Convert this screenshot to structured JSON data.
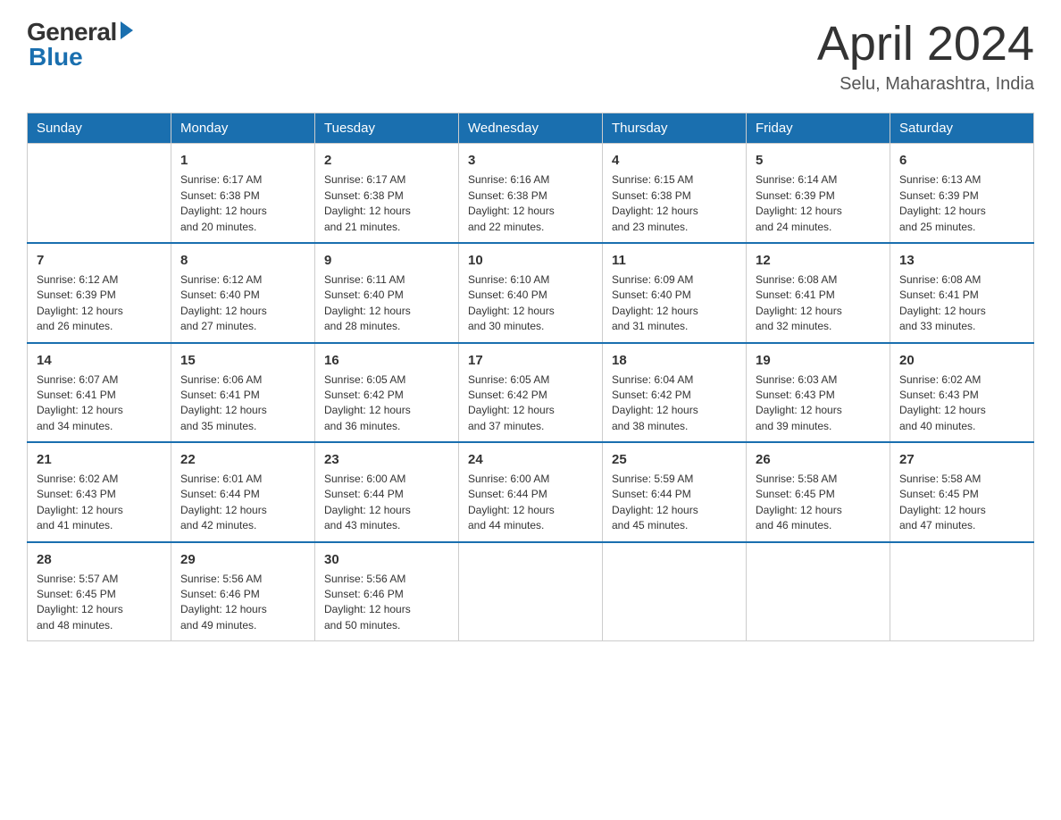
{
  "header": {
    "logo": {
      "general": "General",
      "blue": "Blue"
    },
    "title": "April 2024",
    "location": "Selu, Maharashtra, India"
  },
  "days_of_week": [
    "Sunday",
    "Monday",
    "Tuesday",
    "Wednesday",
    "Thursday",
    "Friday",
    "Saturday"
  ],
  "weeks": [
    [
      {
        "day": "",
        "info": ""
      },
      {
        "day": "1",
        "info": "Sunrise: 6:17 AM\nSunset: 6:38 PM\nDaylight: 12 hours\nand 20 minutes."
      },
      {
        "day": "2",
        "info": "Sunrise: 6:17 AM\nSunset: 6:38 PM\nDaylight: 12 hours\nand 21 minutes."
      },
      {
        "day": "3",
        "info": "Sunrise: 6:16 AM\nSunset: 6:38 PM\nDaylight: 12 hours\nand 22 minutes."
      },
      {
        "day": "4",
        "info": "Sunrise: 6:15 AM\nSunset: 6:38 PM\nDaylight: 12 hours\nand 23 minutes."
      },
      {
        "day": "5",
        "info": "Sunrise: 6:14 AM\nSunset: 6:39 PM\nDaylight: 12 hours\nand 24 minutes."
      },
      {
        "day": "6",
        "info": "Sunrise: 6:13 AM\nSunset: 6:39 PM\nDaylight: 12 hours\nand 25 minutes."
      }
    ],
    [
      {
        "day": "7",
        "info": "Sunrise: 6:12 AM\nSunset: 6:39 PM\nDaylight: 12 hours\nand 26 minutes."
      },
      {
        "day": "8",
        "info": "Sunrise: 6:12 AM\nSunset: 6:40 PM\nDaylight: 12 hours\nand 27 minutes."
      },
      {
        "day": "9",
        "info": "Sunrise: 6:11 AM\nSunset: 6:40 PM\nDaylight: 12 hours\nand 28 minutes."
      },
      {
        "day": "10",
        "info": "Sunrise: 6:10 AM\nSunset: 6:40 PM\nDaylight: 12 hours\nand 30 minutes."
      },
      {
        "day": "11",
        "info": "Sunrise: 6:09 AM\nSunset: 6:40 PM\nDaylight: 12 hours\nand 31 minutes."
      },
      {
        "day": "12",
        "info": "Sunrise: 6:08 AM\nSunset: 6:41 PM\nDaylight: 12 hours\nand 32 minutes."
      },
      {
        "day": "13",
        "info": "Sunrise: 6:08 AM\nSunset: 6:41 PM\nDaylight: 12 hours\nand 33 minutes."
      }
    ],
    [
      {
        "day": "14",
        "info": "Sunrise: 6:07 AM\nSunset: 6:41 PM\nDaylight: 12 hours\nand 34 minutes."
      },
      {
        "day": "15",
        "info": "Sunrise: 6:06 AM\nSunset: 6:41 PM\nDaylight: 12 hours\nand 35 minutes."
      },
      {
        "day": "16",
        "info": "Sunrise: 6:05 AM\nSunset: 6:42 PM\nDaylight: 12 hours\nand 36 minutes."
      },
      {
        "day": "17",
        "info": "Sunrise: 6:05 AM\nSunset: 6:42 PM\nDaylight: 12 hours\nand 37 minutes."
      },
      {
        "day": "18",
        "info": "Sunrise: 6:04 AM\nSunset: 6:42 PM\nDaylight: 12 hours\nand 38 minutes."
      },
      {
        "day": "19",
        "info": "Sunrise: 6:03 AM\nSunset: 6:43 PM\nDaylight: 12 hours\nand 39 minutes."
      },
      {
        "day": "20",
        "info": "Sunrise: 6:02 AM\nSunset: 6:43 PM\nDaylight: 12 hours\nand 40 minutes."
      }
    ],
    [
      {
        "day": "21",
        "info": "Sunrise: 6:02 AM\nSunset: 6:43 PM\nDaylight: 12 hours\nand 41 minutes."
      },
      {
        "day": "22",
        "info": "Sunrise: 6:01 AM\nSunset: 6:44 PM\nDaylight: 12 hours\nand 42 minutes."
      },
      {
        "day": "23",
        "info": "Sunrise: 6:00 AM\nSunset: 6:44 PM\nDaylight: 12 hours\nand 43 minutes."
      },
      {
        "day": "24",
        "info": "Sunrise: 6:00 AM\nSunset: 6:44 PM\nDaylight: 12 hours\nand 44 minutes."
      },
      {
        "day": "25",
        "info": "Sunrise: 5:59 AM\nSunset: 6:44 PM\nDaylight: 12 hours\nand 45 minutes."
      },
      {
        "day": "26",
        "info": "Sunrise: 5:58 AM\nSunset: 6:45 PM\nDaylight: 12 hours\nand 46 minutes."
      },
      {
        "day": "27",
        "info": "Sunrise: 5:58 AM\nSunset: 6:45 PM\nDaylight: 12 hours\nand 47 minutes."
      }
    ],
    [
      {
        "day": "28",
        "info": "Sunrise: 5:57 AM\nSunset: 6:45 PM\nDaylight: 12 hours\nand 48 minutes."
      },
      {
        "day": "29",
        "info": "Sunrise: 5:56 AM\nSunset: 6:46 PM\nDaylight: 12 hours\nand 49 minutes."
      },
      {
        "day": "30",
        "info": "Sunrise: 5:56 AM\nSunset: 6:46 PM\nDaylight: 12 hours\nand 50 minutes."
      },
      {
        "day": "",
        "info": ""
      },
      {
        "day": "",
        "info": ""
      },
      {
        "day": "",
        "info": ""
      },
      {
        "day": "",
        "info": ""
      }
    ]
  ]
}
